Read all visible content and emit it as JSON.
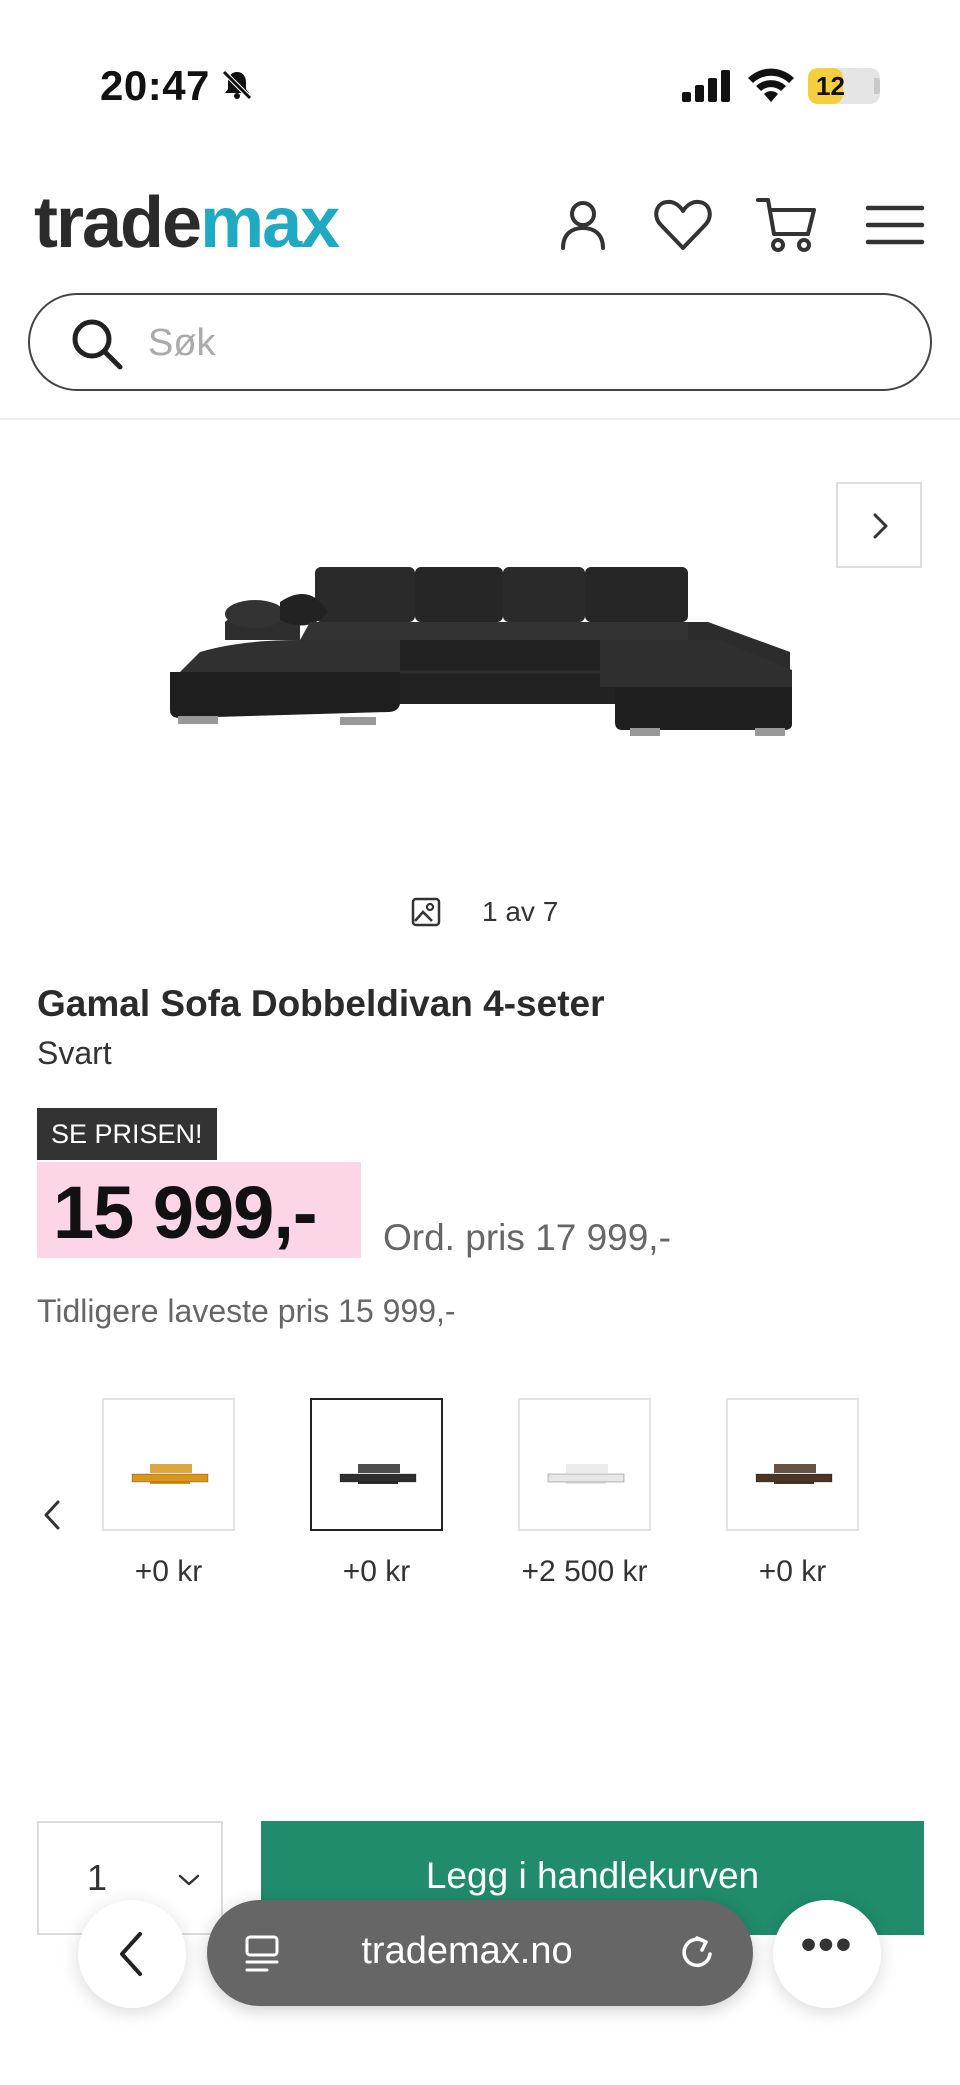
{
  "status_bar": {
    "time": "20:47",
    "battery": "12",
    "battery_level": 0.12
  },
  "header": {
    "logo_part1": "trade",
    "logo_part2": "max",
    "brand_color": "#1fa9c3",
    "icons": [
      "user-icon",
      "heart-icon",
      "cart-icon",
      "menu-icon"
    ]
  },
  "search": {
    "placeholder": "Søk",
    "value": ""
  },
  "gallery": {
    "counter": "1 av 7"
  },
  "product": {
    "title": "Gamal Sofa Dobbeldivan 4-seter",
    "color": "Svart",
    "badge": "SE PRISEN!",
    "price": "15 999,-",
    "ordinary_price": "Ord. pris 17 999,-",
    "lowest_price": "Tidligere laveste pris 15 999,-",
    "price_highlight_color": "#fcd5e7"
  },
  "variants": [
    {
      "price": "+0 kr",
      "color": "#d8961c",
      "selected": false
    },
    {
      "price": "+0 kr",
      "color": "#2e2e2e",
      "selected": true
    },
    {
      "price": "+2 500 kr",
      "color": "#e7e7e7",
      "selected": false
    },
    {
      "price": "+0 kr",
      "color": "#4a3526",
      "selected": false
    }
  ],
  "purchase": {
    "quantity": "1",
    "add_to_cart_label": "Legg i handlekurven",
    "button_color": "#208c6b"
  },
  "browser": {
    "url": "trademax.no"
  }
}
